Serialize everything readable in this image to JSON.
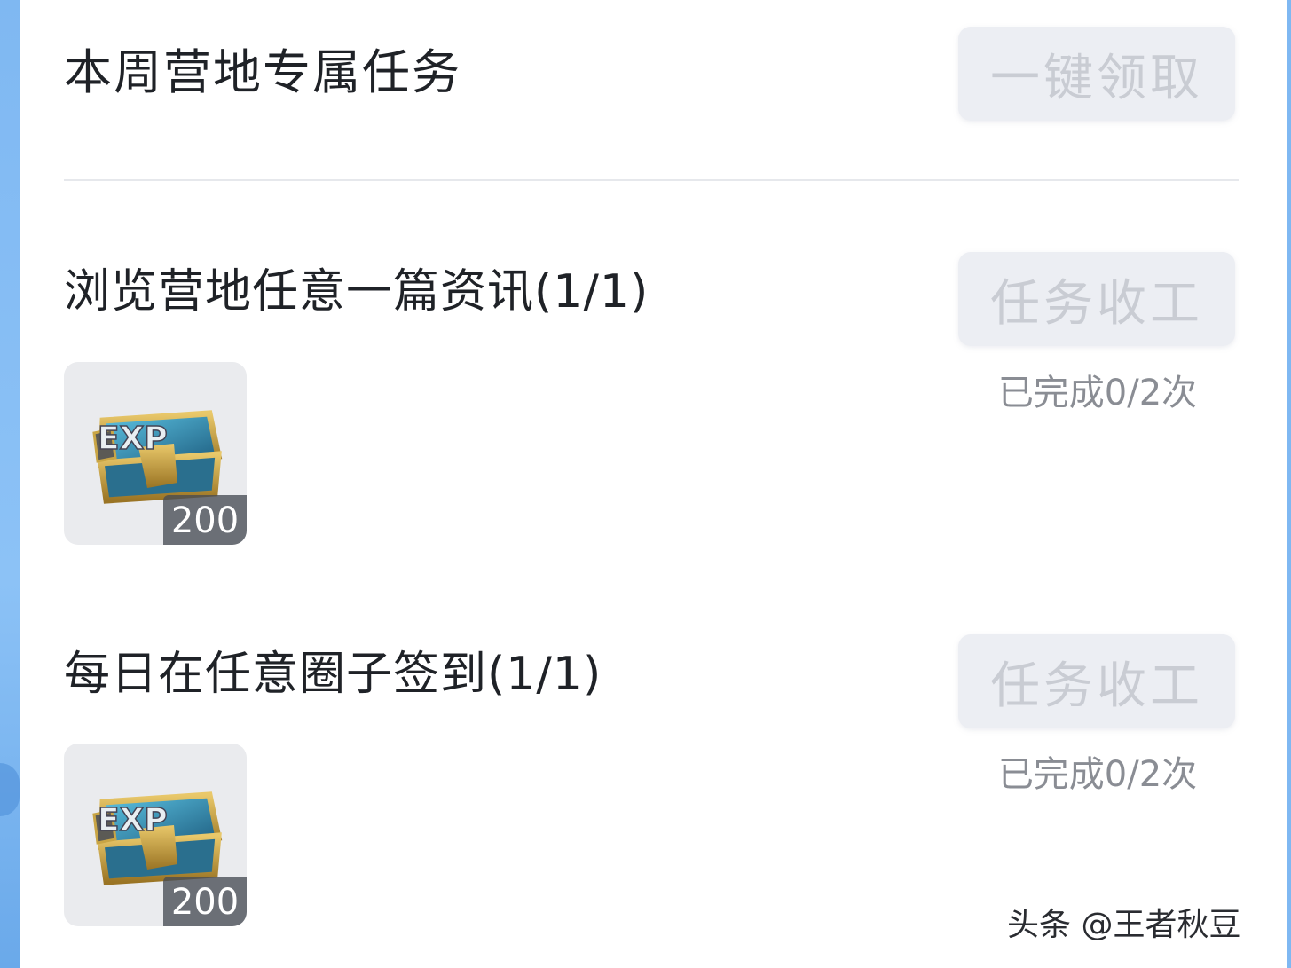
{
  "header": {
    "title": "本周营地专属任务",
    "claim_all_label": "一键领取"
  },
  "tasks": [
    {
      "title": "浏览营地任意一篇资讯(1/1)",
      "button_label": "任务收工",
      "progress_text": "已完成0/2次",
      "reward": {
        "icon": "exp-chest-icon",
        "badge_text": "EXP",
        "count": "200"
      }
    },
    {
      "title": "每日在任意圈子签到(1/1)",
      "button_label": "任务收工",
      "progress_text": "已完成0/2次",
      "reward": {
        "icon": "exp-chest-icon",
        "badge_text": "EXP",
        "count": "200"
      }
    }
  ],
  "watermark": "头条 @王者秋豆",
  "colors": {
    "accent_side": "#7fb8f2",
    "button_bg": "#eceef3",
    "button_text": "#c9ccd3",
    "title_text": "#1f2227",
    "muted_text": "#8a8d94"
  }
}
